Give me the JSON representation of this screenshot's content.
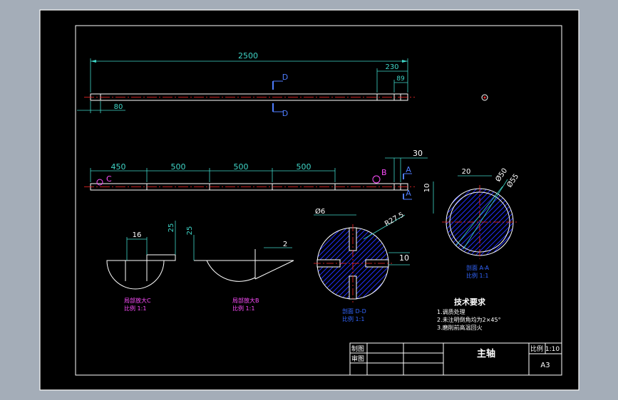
{
  "colors": {
    "background": "#a4adb8",
    "paper": "#000000",
    "line": "#ffffff",
    "dimension": "#3fd6c8",
    "centerline": "#ff2a2a",
    "label_magenta": "#ff4dff",
    "label_blue": "#4f7dff",
    "hatch": "#2430ff",
    "accent_blue": "#3366ff"
  },
  "top_view": {
    "dims": {
      "overall": "2500",
      "right_seg": "230",
      "right_small": "89",
      "left_small": "80"
    },
    "section_mark": "D"
  },
  "mid_view": {
    "dims": {
      "seg1": "450",
      "seg2": "500",
      "seg3": "500",
      "seg4": "500",
      "right": "30"
    },
    "markers": {
      "c": "C",
      "b": "B",
      "a": "A"
    }
  },
  "detail_c": {
    "dim_width": "16",
    "dim_height": "25",
    "title": "局部放大C",
    "scale": "比例 1:1"
  },
  "detail_b": {
    "dim_height": "25",
    "dim_depth": "2",
    "title": "局部放大B",
    "scale": "比例 1:1"
  },
  "section_dd": {
    "dia": "Ø6",
    "radius": "R27.5",
    "width": "10",
    "title": "剖面 D-D",
    "scale": "比例 1:1"
  },
  "section_aa": {
    "dim20": "20",
    "dim10": "10",
    "dia50": "Ø50",
    "dia55": "Ø55",
    "title": "剖面 A-A",
    "scale": "比例 1:1"
  },
  "tech": {
    "title": "技术要求",
    "items": [
      "1.调质处理",
      "2.未注明倒角均为2×45°",
      "3.磨削前高温回火"
    ]
  },
  "title_block": {
    "drawn_by": "制图",
    "checked_by": "审图",
    "part_name": "主轴",
    "scale": "比例 1:10",
    "sheet": "A3"
  }
}
